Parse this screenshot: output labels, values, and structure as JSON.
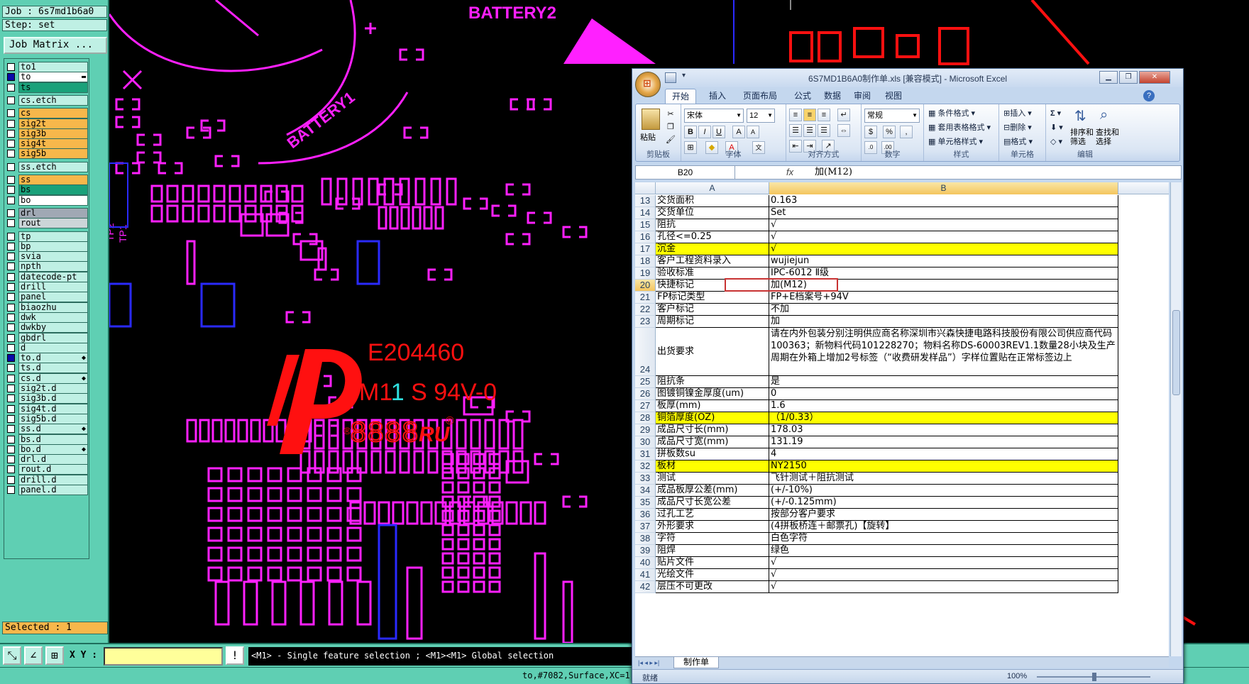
{
  "cam": {
    "job_line": "Job : 6s7md1b6a0",
    "step_line": "Step: set",
    "job_matrix_label": "Job Matrix ...",
    "selected_label": "Selected : 1",
    "xy_label": "X Y :",
    "xy_value": "",
    "hint_text": "<M1> - Single feature selection ; <M1><M1> Global selection",
    "status_text": "to,#7082,Surface,XC=1.",
    "layers": [
      {
        "name": "to1",
        "style": "",
        "checked": false,
        "flag": ""
      },
      {
        "name": "to",
        "style": "w",
        "checked": true,
        "flag": "▬",
        "sep_before": false
      },
      {
        "name": "ts",
        "style": "g",
        "checked": false,
        "flag": ""
      },
      {
        "name": "cs.etch",
        "style": "",
        "checked": false,
        "flag": "",
        "gap": true
      },
      {
        "name": "cs",
        "style": "o",
        "checked": false,
        "flag": "",
        "gap": true
      },
      {
        "name": "sig2t",
        "style": "o",
        "checked": false,
        "flag": ""
      },
      {
        "name": "sig3b",
        "style": "o",
        "checked": false,
        "flag": ""
      },
      {
        "name": "sig4t",
        "style": "o",
        "checked": false,
        "flag": ""
      },
      {
        "name": "sig5b",
        "style": "o",
        "checked": false,
        "flag": ""
      },
      {
        "name": "ss.etch",
        "style": "",
        "checked": false,
        "flag": "",
        "gap": true
      },
      {
        "name": "ss",
        "style": "o",
        "checked": false,
        "flag": "",
        "gap": true
      },
      {
        "name": "bs",
        "style": "g",
        "checked": false,
        "flag": ""
      },
      {
        "name": "bo",
        "style": "w",
        "checked": false,
        "flag": ""
      },
      {
        "name": "drl",
        "style": "gr",
        "checked": false,
        "flag": "",
        "gap": true
      },
      {
        "name": "rout",
        "style": "lg",
        "checked": false,
        "flag": ""
      },
      {
        "name": "tp",
        "style": "",
        "checked": false,
        "flag": "",
        "gap": true
      },
      {
        "name": "bp",
        "style": "",
        "checked": false,
        "flag": ""
      },
      {
        "name": "svia",
        "style": "",
        "checked": false,
        "flag": ""
      },
      {
        "name": "npth",
        "style": "",
        "checked": false,
        "flag": ""
      },
      {
        "name": "datecode-pt",
        "style": "",
        "checked": false,
        "flag": ""
      },
      {
        "name": "drill",
        "style": "",
        "checked": false,
        "flag": ""
      },
      {
        "name": "panel",
        "style": "",
        "checked": false,
        "flag": ""
      },
      {
        "name": "biaozhu",
        "style": "",
        "checked": false,
        "flag": ""
      },
      {
        "name": "dwk",
        "style": "",
        "checked": false,
        "flag": ""
      },
      {
        "name": "dwkby",
        "style": "",
        "checked": false,
        "flag": ""
      },
      {
        "name": "gbdrl",
        "style": "",
        "checked": false,
        "flag": ""
      },
      {
        "name": "d",
        "style": "",
        "checked": false,
        "flag": ""
      },
      {
        "name": "to.d",
        "style": "",
        "checked": true,
        "flag": "◆"
      },
      {
        "name": "ts.d",
        "style": "",
        "checked": false,
        "flag": ""
      },
      {
        "name": "cs.d",
        "style": "",
        "checked": false,
        "flag": "◆"
      },
      {
        "name": "sig2t.d",
        "style": "",
        "checked": false,
        "flag": ""
      },
      {
        "name": "sig3b.d",
        "style": "",
        "checked": false,
        "flag": ""
      },
      {
        "name": "sig4t.d",
        "style": "",
        "checked": false,
        "flag": ""
      },
      {
        "name": "sig5b.d",
        "style": "",
        "checked": false,
        "flag": ""
      },
      {
        "name": "ss.d",
        "style": "",
        "checked": false,
        "flag": "◆"
      },
      {
        "name": "bs.d",
        "style": "",
        "checked": false,
        "flag": ""
      },
      {
        "name": "bo.d",
        "style": "",
        "checked": false,
        "flag": "◆"
      },
      {
        "name": "drl.d",
        "style": "",
        "checked": false,
        "flag": ""
      },
      {
        "name": "rout.d",
        "style": "",
        "checked": false,
        "flag": ""
      },
      {
        "name": "drill.d",
        "style": "",
        "checked": false,
        "flag": ""
      },
      {
        "name": "panel.d",
        "style": "",
        "checked": false,
        "flag": ""
      }
    ]
  },
  "pcb": {
    "labels": {
      "battery2": "BATTERY2",
      "battery1": "BATTERY1",
      "tp1": "TP1",
      "tp2": "TP2",
      "ul_number": "E204460",
      "ul_code_a": "M1",
      "ul_code_b": "1",
      "ul_code_c": " S 94V-0",
      "ul_digits": "8888",
      "ul_mark": "RU"
    },
    "colors": {
      "magenta": "#ff20ff",
      "red": "#ff1010",
      "blue": "#2a2aff"
    }
  },
  "excel": {
    "title": "6S7MD1B6A0制作单.xls [兼容模式] - Microsoft Excel",
    "tabs": [
      "开始",
      "插入",
      "页面布局",
      "公式",
      "数据",
      "审阅",
      "视图"
    ],
    "ribbon": {
      "paste": "粘贴",
      "clipboard": "剪贴板",
      "font_name": "宋体",
      "font_size": "12",
      "font": "字体",
      "alignment": "对齐方式",
      "number_format": "常规",
      "number": "数字",
      "cond_format": "条件格式",
      "table_format": "套用表格格式",
      "cell_style": "单元格样式",
      "styles": "样式",
      "insert": "插入",
      "delete": "删除",
      "format": "格式",
      "cells": "单元格",
      "sort_filter": "排序和\n筛选",
      "find_select": "查找和\n选择",
      "editing": "编辑",
      "sigma": "Σ",
      "bold": "B",
      "italic": "I",
      "underline": "U",
      "percent": "%",
      "comma": ","
    },
    "name_box": "B20",
    "fx": "fx",
    "formula": "加(M12)",
    "columns": [
      "A",
      "B"
    ],
    "rows": [
      {
        "n": "13",
        "a": "交货面积",
        "b": "0.163",
        "y": false
      },
      {
        "n": "14",
        "a": "交货单位",
        "b": "Set",
        "y": false
      },
      {
        "n": "15",
        "a": "阻抗",
        "b": "√",
        "y": false
      },
      {
        "n": "16",
        "a": "孔径<=0.25",
        "b": "√",
        "y": false
      },
      {
        "n": "17",
        "a": "沉金",
        "b": "√",
        "y": true
      },
      {
        "n": "18",
        "a": "客户工程资料录入",
        "b": "wujiejun",
        "y": false
      },
      {
        "n": "19",
        "a": "验收标准",
        "b": "IPC-6012 Ⅱ级",
        "y": false
      },
      {
        "n": "20",
        "a": "快捷标记",
        "b": "加(M12)",
        "y": false,
        "sel": true
      },
      {
        "n": "21",
        "a": "FP标记类型",
        "b": "FP+E档案号+94V",
        "y": false
      },
      {
        "n": "22",
        "a": "客户标记",
        "b": "不加",
        "y": false
      },
      {
        "n": "23",
        "a": "周期标记",
        "b": "加",
        "y": false
      },
      {
        "n": "24",
        "a": "出货要求",
        "b": "请在内外包装分别注明供应商名称深圳市兴森快捷电路科技股份有限公司供应商代码100363；新物料代码101228270；物料名称DS-60003REV1.1数量28小块及生产周期在外箱上增加2号标签（“收费研发样品”）字样位置贴在正常标签边上",
        "y": false,
        "tall": true
      },
      {
        "n": "25",
        "a": "阻抗条",
        "b": "是",
        "y": false
      },
      {
        "n": "26",
        "a": "图镀铜镍金厚度(um)",
        "b": "0",
        "y": false
      },
      {
        "n": "27",
        "a": "板厚(mm)",
        "b": "1.6",
        "y": false
      },
      {
        "n": "28",
        "a": "铜箔厚度(OZ)",
        "b": "（1/0.33）",
        "y": true
      },
      {
        "n": "29",
        "a": "成品尺寸长(mm)",
        "b": "178.03",
        "y": false
      },
      {
        "n": "30",
        "a": "成品尺寸宽(mm)",
        "b": "131.19",
        "y": false
      },
      {
        "n": "31",
        "a": "拼板数su",
        "b": "4",
        "y": false
      },
      {
        "n": "32",
        "a": "板材",
        "b": "NY2150",
        "y": true
      },
      {
        "n": "33",
        "a": "测试",
        "b": "飞针测试＋阻抗测试",
        "y": false
      },
      {
        "n": "34",
        "a": "成品板厚公差(mm)",
        "b": "(+/-10%)",
        "y": false
      },
      {
        "n": "35",
        "a": "成品尺寸长宽公差",
        "b": "(+/-0.125mm)",
        "y": false
      },
      {
        "n": "36",
        "a": "过孔工艺",
        "b": "按部分客户要求",
        "y": false
      },
      {
        "n": "37",
        "a": "外形要求",
        "b": "(4拼板桥连＋邮票孔)【旋转】",
        "y": false
      },
      {
        "n": "38",
        "a": "字符",
        "b": "白色字符",
        "y": false
      },
      {
        "n": "39",
        "a": "阻焊",
        "b": "绿色",
        "y": false
      },
      {
        "n": "40",
        "a": "贴片文件",
        "b": "√",
        "y": false
      },
      {
        "n": "41",
        "a": "光绘文件",
        "b": "√",
        "y": false
      },
      {
        "n": "42",
        "a": "层压不可更改",
        "b": "√",
        "y": false
      }
    ],
    "sheet_tab": "制作单",
    "status_ready": "就绪",
    "zoom": "100%"
  }
}
